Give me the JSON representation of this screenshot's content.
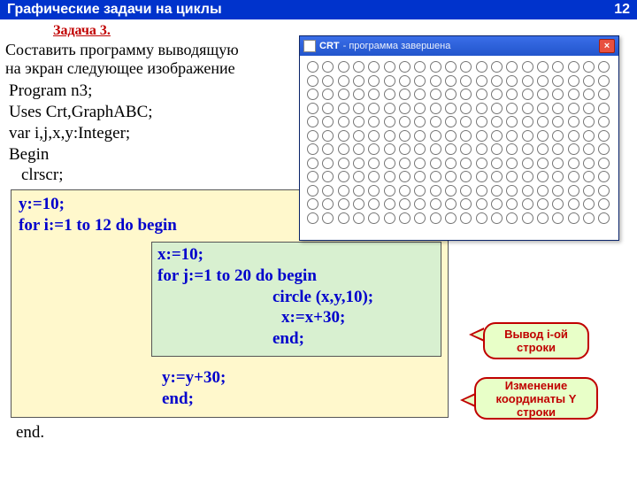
{
  "header": {
    "title": "Графические задачи на циклы",
    "page": "12"
  },
  "task": {
    "label": "Задача 3.",
    "desc1": "Составить программу выводящую",
    "desc2": "на экран следующее изображение"
  },
  "code": {
    "l1": "Program n3;",
    "l2": "Uses Crt,GraphABC;",
    "l3": "var i,j,x,y:Integer;",
    "l4": "Begin",
    "l5": "clrscr;",
    "end": "end."
  },
  "outer": {
    "l1": "y:=10;",
    "l2": "for i:=1 to 12 do begin",
    "after1": "y:=y+30;",
    "after2": "end;"
  },
  "inner": {
    "l1": "x:=10;",
    "l2": "for j:=1 to 20 do begin",
    "l3": "circle (x,y,10);",
    "l4": "x:=x+30;",
    "l5": "end;"
  },
  "callouts": {
    "c1": "Вывод i-ой строки",
    "c2": "Изменение координаты Y строки"
  },
  "window": {
    "title": "CRT",
    "status": "- программа завершена",
    "close": "×",
    "rows": 12,
    "cols": 20
  }
}
